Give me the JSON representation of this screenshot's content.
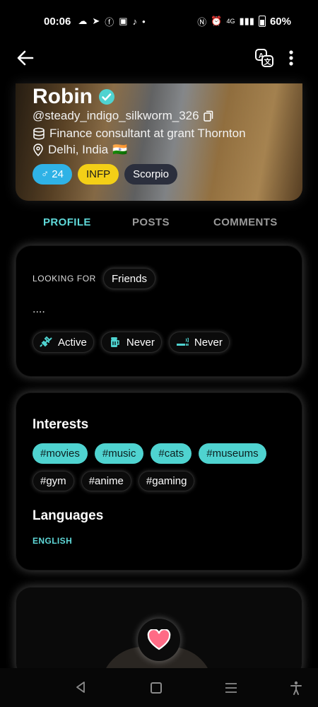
{
  "status_bar": {
    "time": "00:06",
    "network": "4G",
    "battery": "60%"
  },
  "profile": {
    "name": "Robin",
    "handle": "@steady_indigo_silkworm_326",
    "occupation": "Finance consultant at grant Thornton",
    "location": "Delhi, India",
    "flag": "🇮🇳",
    "gender_symbol": "♂",
    "age": "24",
    "mbti": "INFP",
    "zodiac": "Scorpio"
  },
  "tabs": [
    {
      "label": "PROFILE",
      "active": true
    },
    {
      "label": "POSTS",
      "active": false
    },
    {
      "label": "COMMENTS",
      "active": false
    }
  ],
  "about": {
    "looking_for_label": "LOOKING FOR",
    "looking_for_value": "Friends",
    "bio": "....",
    "habits": [
      {
        "icon": "fitness-icon",
        "label": "Active"
      },
      {
        "icon": "drink-icon",
        "label": "Never"
      },
      {
        "icon": "smoking-icon",
        "label": "Never"
      }
    ]
  },
  "interests": {
    "title": "Interests",
    "highlighted": [
      "#movies",
      "#music",
      "#cats",
      "#museums"
    ],
    "others": [
      "#gym",
      "#anime",
      "#gaming"
    ]
  },
  "languages": {
    "title": "Languages",
    "items": [
      "ENGLISH"
    ]
  },
  "colors": {
    "accent": "#5fd8d8",
    "tag_highlight": "#4fd3d0",
    "gender_chip": "#2fb2e6",
    "mbti_chip": "#f3cf17",
    "like_heart": "#ff6b86"
  }
}
